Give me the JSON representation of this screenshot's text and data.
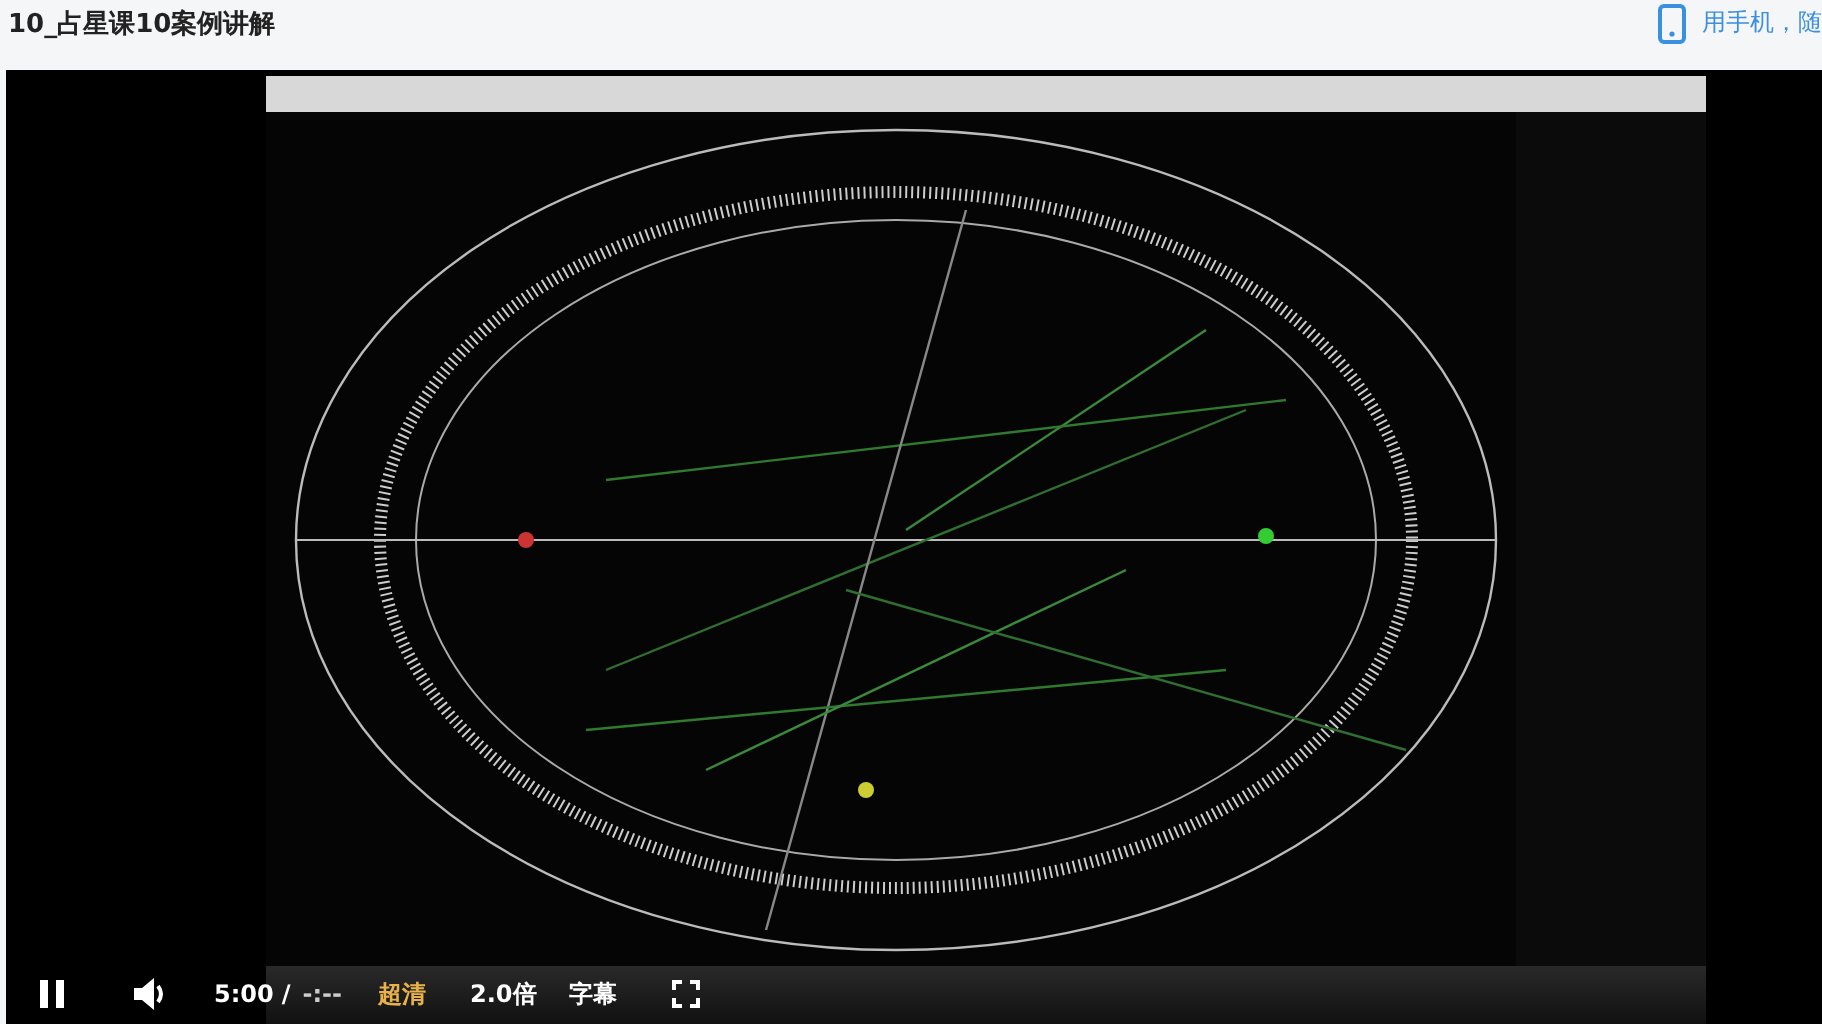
{
  "header": {
    "title": "10_占星课10案例讲解",
    "mobile_link": "用手机，随"
  },
  "controls": {
    "playing": true,
    "current_time": "5:00",
    "separator": "/",
    "duration": "-:--",
    "quality": "超清",
    "speed": "2.0倍",
    "subtitles": "字幕"
  }
}
